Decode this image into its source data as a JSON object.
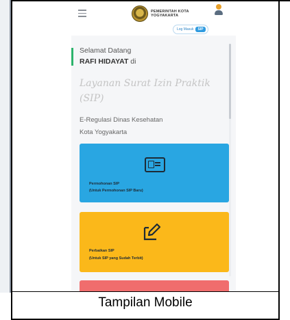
{
  "header": {
    "logo_text_line1": "PEMERINTAH KOTA",
    "logo_text_line2": "YOGYAKARTA",
    "pill_label": "Log Masuk",
    "pill_badge": "SIP"
  },
  "welcome": {
    "greeting": "Selamat Datang",
    "user_name": "RAFI HIDAYAT",
    "suffix": " di",
    "app_name_line1": "Layanan Surat Izin Praktik",
    "app_name_line2": "(SIP)",
    "desc_line1": "E-Regulasi Dinas Kesehatan",
    "desc_line2": "Kota Yogyakarta"
  },
  "cards": [
    {
      "title": "Permohonan SIP",
      "subtitle": "(Untuk Permohonan SIP Baru)"
    },
    {
      "title": "Perbaikan SIP",
      "subtitle": "(Untuk SIP yang Sudah Terbit)"
    }
  ],
  "caption": "Tampilan Mobile",
  "colors": {
    "blue_card": "#29a6e2",
    "yellow_card": "#fbb81a",
    "red_card": "#f06d6d",
    "accent_green": "#2db36c"
  },
  "icons": [
    "hamburger-icon",
    "crest-icon",
    "user-icon",
    "id-card-icon",
    "edit-icon"
  ]
}
